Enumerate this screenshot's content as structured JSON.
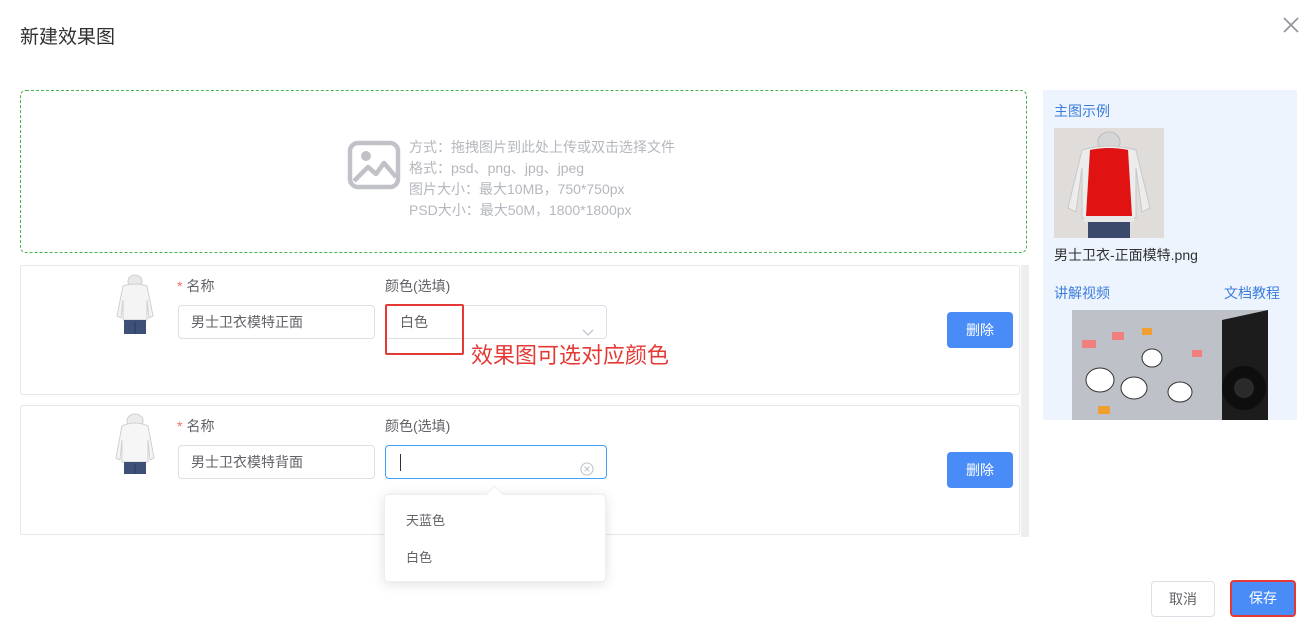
{
  "dialog": {
    "title": "新建效果图"
  },
  "upload": {
    "hints": [
      "方式：拖拽图片到此处上传或双击选择文件",
      "格式：psd、png、jpg、jpeg",
      "图片大小：最大10MB，750*750px",
      "PSD大小：最大50M，1800*1800px"
    ]
  },
  "items": [
    {
      "name_label": "名称",
      "required_mark": "*",
      "color_label": "颜色(选填)",
      "name_value": "男士卫衣模特正面",
      "color_value": "白色",
      "delete_label": "删除"
    },
    {
      "name_label": "名称",
      "required_mark": "*",
      "color_label": "颜色(选填)",
      "name_value": "男士卫衣模特背面",
      "color_value": "",
      "delete_label": "删除"
    }
  ],
  "annotation": "效果图可选对应颜色",
  "dropdown": {
    "options": [
      "天蓝色",
      "白色"
    ]
  },
  "panel": {
    "example_title": "主图示例",
    "example_filename": "男士卫衣-正面模特.png",
    "video_link": "讲解视频",
    "doc_link": "文档教程"
  },
  "footer": {
    "cancel": "取消",
    "save": "保存"
  },
  "colors": {
    "primary": "#4a8cf7",
    "annotation_red": "#e53935",
    "upload_border": "#4caf50",
    "panel_bg": "#eef4fd"
  },
  "icons": {
    "close": "close-icon",
    "upload": "image-placeholder-icon",
    "chevron": "chevron-down-icon",
    "clear": "clear-circle-icon"
  }
}
